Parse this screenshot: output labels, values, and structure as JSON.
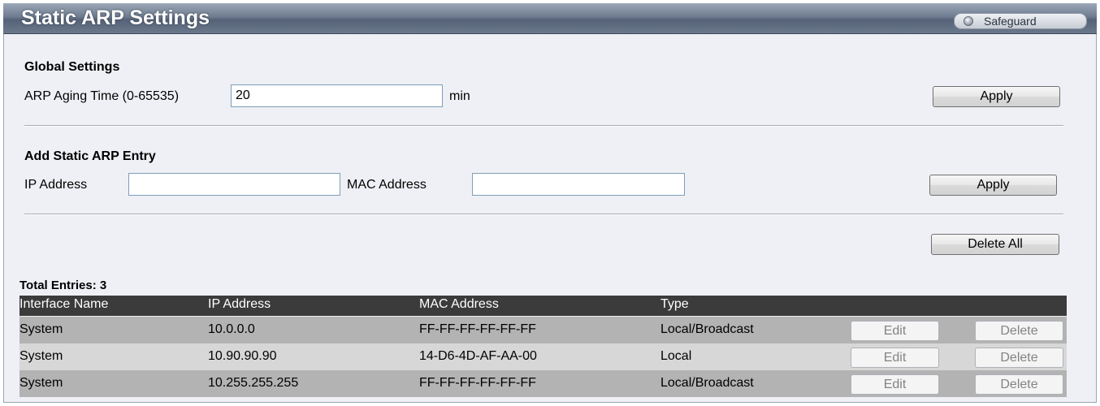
{
  "header": {
    "title": "Static ARP Settings",
    "safeguard_label": "Safeguard"
  },
  "global_settings": {
    "heading": "Global Settings",
    "aging_label": "ARP Aging Time (0-65535)",
    "aging_value": "20",
    "unit": "min",
    "apply_label": "Apply"
  },
  "add_entry": {
    "heading": "Add Static ARP Entry",
    "ip_label": "IP Address",
    "ip_value": "",
    "mac_label": "MAC Address",
    "mac_value": "",
    "apply_label": "Apply"
  },
  "delete_all_label": "Delete All",
  "table": {
    "total_entries": "Total Entries: 3",
    "headers": [
      "Interface Name",
      "IP Address",
      "MAC Address",
      "Type"
    ],
    "rows": [
      {
        "interface": "System",
        "ip": "10.0.0.0",
        "mac": "FF-FF-FF-FF-FF-FF",
        "type": "Local/Broadcast",
        "edit": "Edit",
        "delete": "Delete"
      },
      {
        "interface": "System",
        "ip": "10.90.90.90",
        "mac": "14-D6-4D-AF-AA-00",
        "type": "Local",
        "edit": "Edit",
        "delete": "Delete"
      },
      {
        "interface": "System",
        "ip": "10.255.255.255",
        "mac": "FF-FF-FF-FF-FF-FF",
        "type": "Local/Broadcast",
        "edit": "Edit",
        "delete": "Delete"
      }
    ]
  },
  "colors": {
    "header_bar": "#3b3b3b",
    "row_odd": "#b3b3b3",
    "row_even": "#d7d7d7",
    "panel_bg": "#eef0f5"
  }
}
